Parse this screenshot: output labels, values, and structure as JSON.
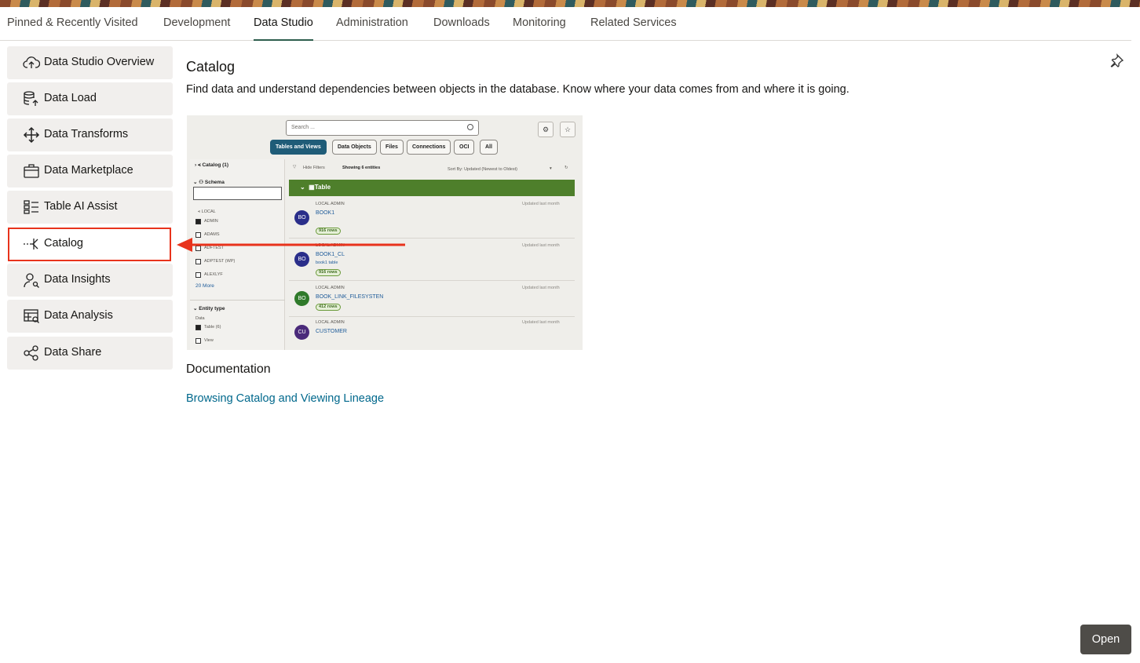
{
  "tabs": [
    {
      "label": "Pinned & Recently Visited"
    },
    {
      "label": "Development"
    },
    {
      "label": "Data Studio",
      "active": true
    },
    {
      "label": "Administration"
    },
    {
      "label": "Downloads"
    },
    {
      "label": "Monitoring"
    },
    {
      "label": "Related Services"
    }
  ],
  "sidebar": {
    "items": [
      {
        "label": "Data Studio Overview",
        "icon": "cloud-upload-icon"
      },
      {
        "label": "Data Load",
        "icon": "database-upload-icon"
      },
      {
        "label": "Data Transforms",
        "icon": "move-arrows-icon"
      },
      {
        "label": "Data Marketplace",
        "icon": "briefcase-icon"
      },
      {
        "label": "Table AI Assist",
        "icon": "table-list-icon"
      },
      {
        "label": "Catalog",
        "icon": "catalog-lineage-icon",
        "selected": true
      },
      {
        "label": "Data Insights",
        "icon": "person-search-icon"
      },
      {
        "label": "Data Analysis",
        "icon": "table-search-icon"
      },
      {
        "label": "Data Share",
        "icon": "share-nodes-icon"
      }
    ]
  },
  "main": {
    "title": "Catalog",
    "description": "Find data and understand dependencies between objects in the database. Know where your data comes from and where it is going.",
    "documentation_title": "Documentation",
    "documentation_link": "Browsing Catalog and Viewing Lineage",
    "open_label": "Open"
  },
  "preview": {
    "search_placeholder": "Search ...",
    "chips": [
      "Tables and Views",
      "Data Objects",
      "Files",
      "Connections",
      "OCI",
      "All"
    ],
    "catalog_label": "Catalog (1)",
    "schema_label": "Schema",
    "local_label": "LOCAL",
    "schemas": [
      {
        "name": "ADMIN",
        "checked": true
      },
      {
        "name": "ADAMS",
        "checked": false
      },
      {
        "name": "ADFTEST",
        "checked": false
      },
      {
        "name": "ADPTEST (WP)",
        "checked": false
      },
      {
        "name": "ALEXLYF",
        "checked": false
      }
    ],
    "more_label": "20 More",
    "entity_type_label": "Entity type",
    "data_label": "Data",
    "entity_table": "Table (6)",
    "entity_view": "View",
    "hide_filters": "Hide Filters",
    "showing": "Showing 6 entities",
    "sort_by": "Sort By: Updated (Newest to Oldest)",
    "table_header": "Table",
    "rows": [
      {
        "initials": "BO",
        "name": "BOOK1",
        "meta": "LOCAL  ADMIN",
        "sub": "",
        "rows": "916 rows",
        "updated": "Updated last month",
        "color": "#2a2e8a"
      },
      {
        "initials": "BO",
        "name": "BOOK1_CL",
        "meta": "LOCAL  ADMIN",
        "sub": "book1 table",
        "rows": "916 rows",
        "updated": "Updated last month",
        "color": "#2a2e8a"
      },
      {
        "initials": "BO",
        "name": "BOOK_LINK_FILESYSTEN",
        "meta": "LOCAL  ADMIN",
        "sub": "",
        "rows": "412 rows",
        "updated": "Updated last month",
        "color": "#2f7a2a"
      },
      {
        "initials": "CU",
        "name": "CUSTOMER",
        "meta": "LOCAL  ADMIN",
        "sub": "",
        "rows": "",
        "updated": "Updated last month",
        "color": "#4a2a7a"
      }
    ]
  },
  "colors": {
    "accent": "#2e5e4e",
    "highlight": "#e8331c",
    "link": "#00688c",
    "table_bar": "#4e7f2b"
  }
}
